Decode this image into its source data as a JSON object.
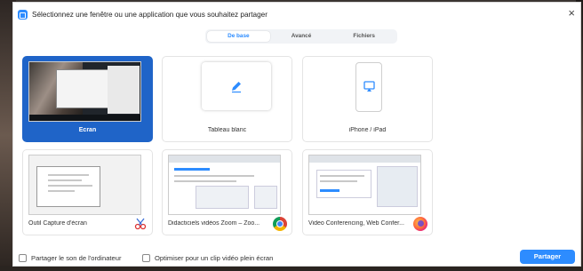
{
  "window": {
    "title": "Sélectionnez une fenêtre ou une application que vous souhaitez partager",
    "close_glyph": "×"
  },
  "tabs": [
    {
      "label": "De base",
      "active": true
    },
    {
      "label": "Avancé",
      "active": false
    },
    {
      "label": "Fichiers",
      "active": false
    }
  ],
  "sources": [
    {
      "label": "Écran",
      "selected": true,
      "thumbnail": "screen-preview"
    },
    {
      "label": "Tableau blanc",
      "selected": false,
      "thumbnail": "pencil-icon"
    },
    {
      "label": "iPhone / iPad",
      "selected": false,
      "thumbnail": "airplay-icon"
    },
    {
      "label": "Outil Capture d'écran",
      "selected": false,
      "thumbnail": "snipping-tool-window",
      "app_icon": "snipping-tool-icon"
    },
    {
      "label": "Didacticiels vidéos Zoom – Zoo...",
      "selected": false,
      "thumbnail": "zoom-website-window",
      "app_icon": "chrome-icon"
    },
    {
      "label": "Video Conferencing, Web Confer...",
      "selected": false,
      "thumbnail": "zoom-homepage-window",
      "app_icon": "firefox-icon"
    }
  ],
  "footer": {
    "share_sound_label": "Partager le son de l'ordinateur",
    "optimize_video_label": "Optimiser pour un clip vidéo plein écran",
    "share_button_label": "Partager"
  },
  "colors": {
    "accent": "#2d8cff",
    "selected_card": "#1f64c8"
  }
}
